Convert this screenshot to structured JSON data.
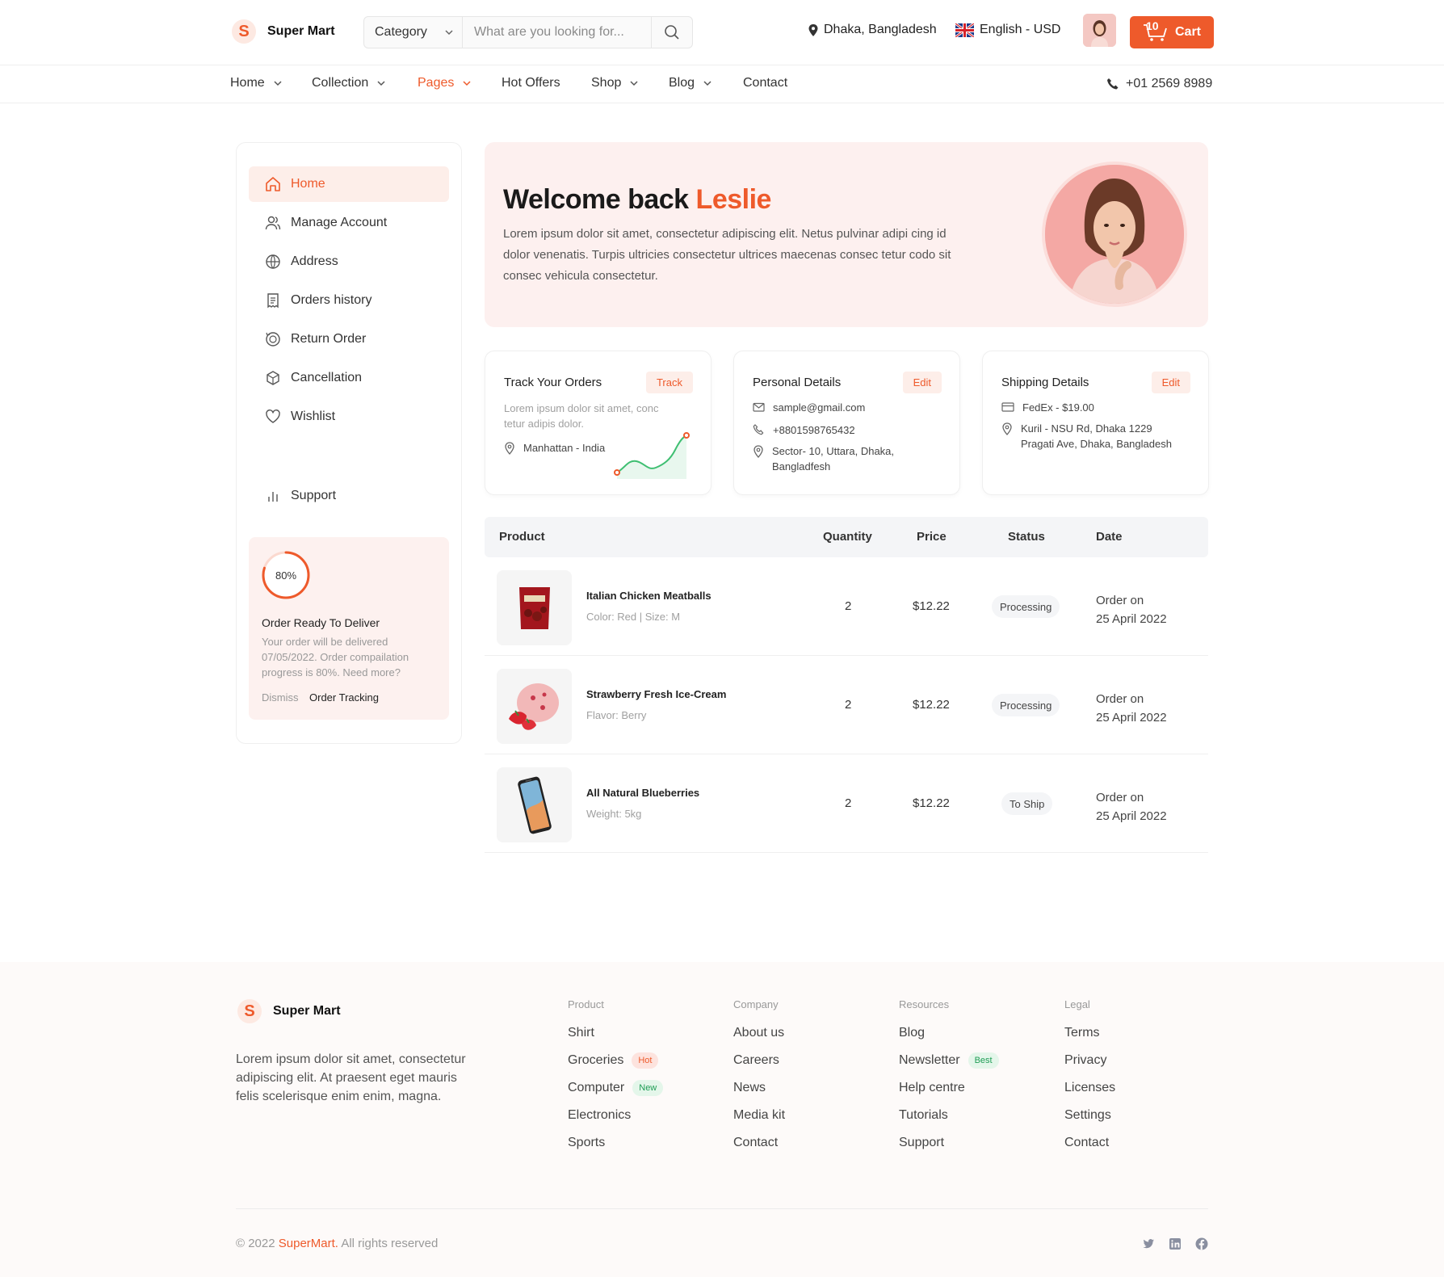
{
  "header": {
    "brand_letter": "S",
    "brand_name": "Super Mart",
    "category_label": "Category",
    "search_placeholder": "What are you looking for...",
    "location": "Dhaka, Bangladesh",
    "language": "English - USD",
    "cart_count": "10",
    "cart_label": "Cart",
    "accent_color": "#ee5a2b"
  },
  "nav": {
    "items": [
      {
        "label": "Home"
      },
      {
        "label": "Collection"
      },
      {
        "label": "Pages"
      },
      {
        "label": "Hot Offers"
      },
      {
        "label": "Shop"
      },
      {
        "label": "Blog"
      },
      {
        "label": "Contact"
      }
    ],
    "phone": "+01 2569 8989"
  },
  "sidebar": {
    "items": [
      {
        "label": "Home",
        "icon": "home-icon"
      },
      {
        "label": "Manage Account",
        "icon": "users-icon"
      },
      {
        "label": "Address",
        "icon": "globe-icon"
      },
      {
        "label": "Orders history",
        "icon": "receipt-icon"
      },
      {
        "label": "Return Order",
        "icon": "return-icon"
      },
      {
        "label": "Cancellation",
        "icon": "box-icon"
      },
      {
        "label": "Wishlist",
        "icon": "heart-icon"
      },
      {
        "label": "Support",
        "icon": "bar-chart-icon"
      }
    ],
    "promo": {
      "progress": 80,
      "progress_label": "80%",
      "title": "Order Ready To Deliver",
      "text": "Your order will be delivered 07/05/2022. Order compailation progress is 80%. Need more?",
      "dismiss": "Dismiss",
      "tracking": "Order Tracking"
    }
  },
  "welcome": {
    "title": "Welcome back",
    "name": "Leslie",
    "text": "Lorem ipsum dolor sit amet, consectetur adipiscing elit. Netus pulvinar adipi cing id dolor venenatis. Turpis ultricies consectetur ultrices maecenas consec tetur codo sit consec vehicula consectetur."
  },
  "cards": {
    "track": {
      "title": "Track Your Orders",
      "action": "Track",
      "text": "Lorem ipsum dolor sit amet, conc tetur adipis dolor.",
      "location": "Manhattan - India"
    },
    "personal": {
      "title": "Personal Details",
      "action": "Edit",
      "email": "sample@gmail.com",
      "phone": "+8801598765432",
      "address": "Sector- 10, Uttara, Dhaka, Bangladfesh"
    },
    "shipping": {
      "title": "Shipping Details",
      "action": "Edit",
      "carrier": "FedEx - $19.00",
      "address": "Kuril - NSU Rd, Dhaka 1229 Pragati Ave, Dhaka, Bangladesh"
    }
  },
  "table": {
    "headers": {
      "product": "Product",
      "quantity": "Quantity",
      "price": "Price",
      "status": "Status",
      "date": "Date"
    },
    "rows": [
      {
        "name": "Italian Chicken Meatballs",
        "meta": "Color: Red | Size: M",
        "qty": "2",
        "price": "$12.22",
        "status": "Processing",
        "date_label": "Order on",
        "date": "25 April 2022"
      },
      {
        "name": "Strawberry Fresh Ice-Cream",
        "meta": "Flavor: Berry",
        "qty": "2",
        "price": "$12.22",
        "status": "Processing",
        "date_label": "Order on",
        "date": "25 April 2022"
      },
      {
        "name": "All Natural Blueberries",
        "meta": "Weight: 5kg",
        "qty": "2",
        "price": "$12.22",
        "status": "To Ship",
        "date_label": "Order on",
        "date": "25 April 2022"
      }
    ]
  },
  "footer": {
    "brand_letter": "S",
    "brand_name": "Super Mart",
    "description": "Lorem ipsum dolor sit amet, consectetur adipiscing elit. At praesent eget mauris felis scelerisque enim enim, magna.",
    "columns": [
      {
        "title": "Product",
        "links": [
          "Shirt",
          "Groceries",
          "Computer",
          "Electronics",
          "Sports"
        ]
      },
      {
        "title": "Company",
        "links": [
          "About us",
          "Careers",
          "News",
          "Media kit",
          "Contact"
        ]
      },
      {
        "title": "Resources",
        "links": [
          "Blog",
          "Newsletter",
          "Help centre",
          "Tutorials",
          "Support"
        ]
      },
      {
        "title": "Legal",
        "links": [
          "Terms",
          "Privacy",
          "Licenses",
          "Settings",
          "Contact"
        ]
      }
    ],
    "tags": {
      "hot": "Hot",
      "new": "New",
      "best": "Best"
    },
    "copyright_prefix": "© 2022",
    "copyright_brand": "SuperMart.",
    "copyright_suffix": "All rights reserved"
  }
}
